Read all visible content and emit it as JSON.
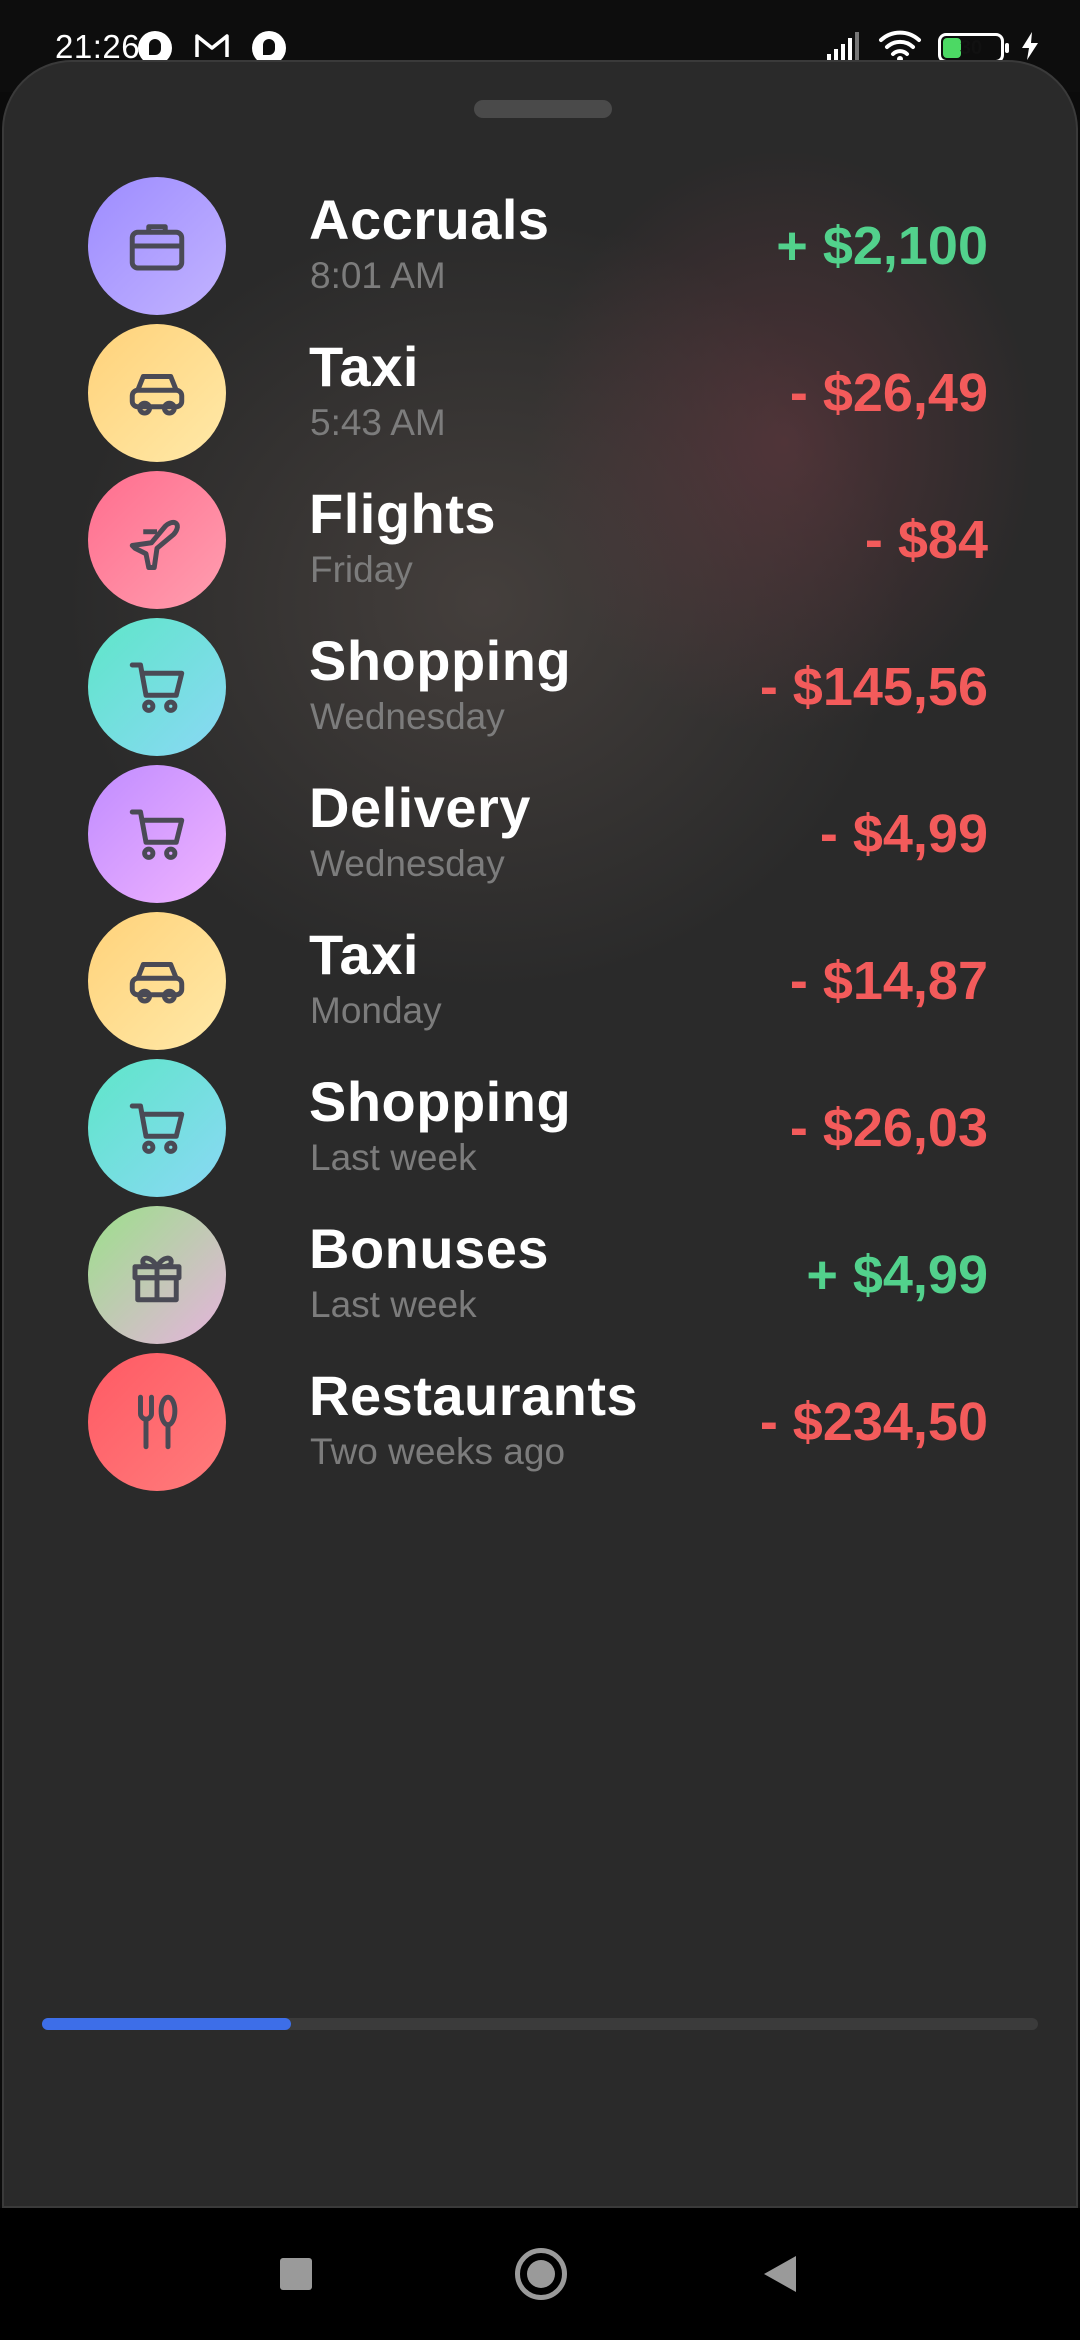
{
  "status_bar": {
    "time": "21:26",
    "left_icons": [
      "app-notification-icon",
      "gmail-icon",
      "app-notification-icon"
    ],
    "right_icons": [
      "signal-icon",
      "wifi-icon",
      "battery-icon",
      "charging-icon"
    ],
    "battery_level": "30"
  },
  "colors": {
    "positive": "#52d18c",
    "negative": "#f35b5b",
    "scroll_thumb": "#3d6ee8"
  },
  "transactions": [
    {
      "title": "Accruals",
      "subtitle": "8:01 AM",
      "amount": "+ $2,100",
      "sign": "positive",
      "icon": "briefcase-icon"
    },
    {
      "title": "Taxi",
      "subtitle": "5:43 AM",
      "amount": "- $26,49",
      "sign": "negative",
      "icon": "car-icon"
    },
    {
      "title": "Flights",
      "subtitle": "Friday",
      "amount": "- $84",
      "sign": "negative",
      "icon": "airplane-icon"
    },
    {
      "title": "Shopping",
      "subtitle": "Wednesday",
      "amount": "- $145,56",
      "sign": "negative",
      "icon": "cart-icon"
    },
    {
      "title": "Delivery",
      "subtitle": "Wednesday",
      "amount": "- $4,99",
      "sign": "negative",
      "icon": "cart-icon"
    },
    {
      "title": "Taxi",
      "subtitle": "Monday",
      "amount": "- $14,87",
      "sign": "negative",
      "icon": "car-icon"
    },
    {
      "title": "Shopping",
      "subtitle": "Last week",
      "amount": "- $26,03",
      "sign": "negative",
      "icon": "cart-icon"
    },
    {
      "title": "Bonuses",
      "subtitle": "Last week",
      "amount": "+ $4,99",
      "sign": "positive",
      "icon": "gift-icon"
    },
    {
      "title": "Restaurants",
      "subtitle": "Two weeks ago",
      "amount": "- $234,50",
      "sign": "negative",
      "icon": "cutlery-icon"
    }
  ],
  "scroll_progress": 0.25,
  "nav_bar": {
    "buttons": [
      "recents-button",
      "home-button",
      "back-button"
    ]
  }
}
